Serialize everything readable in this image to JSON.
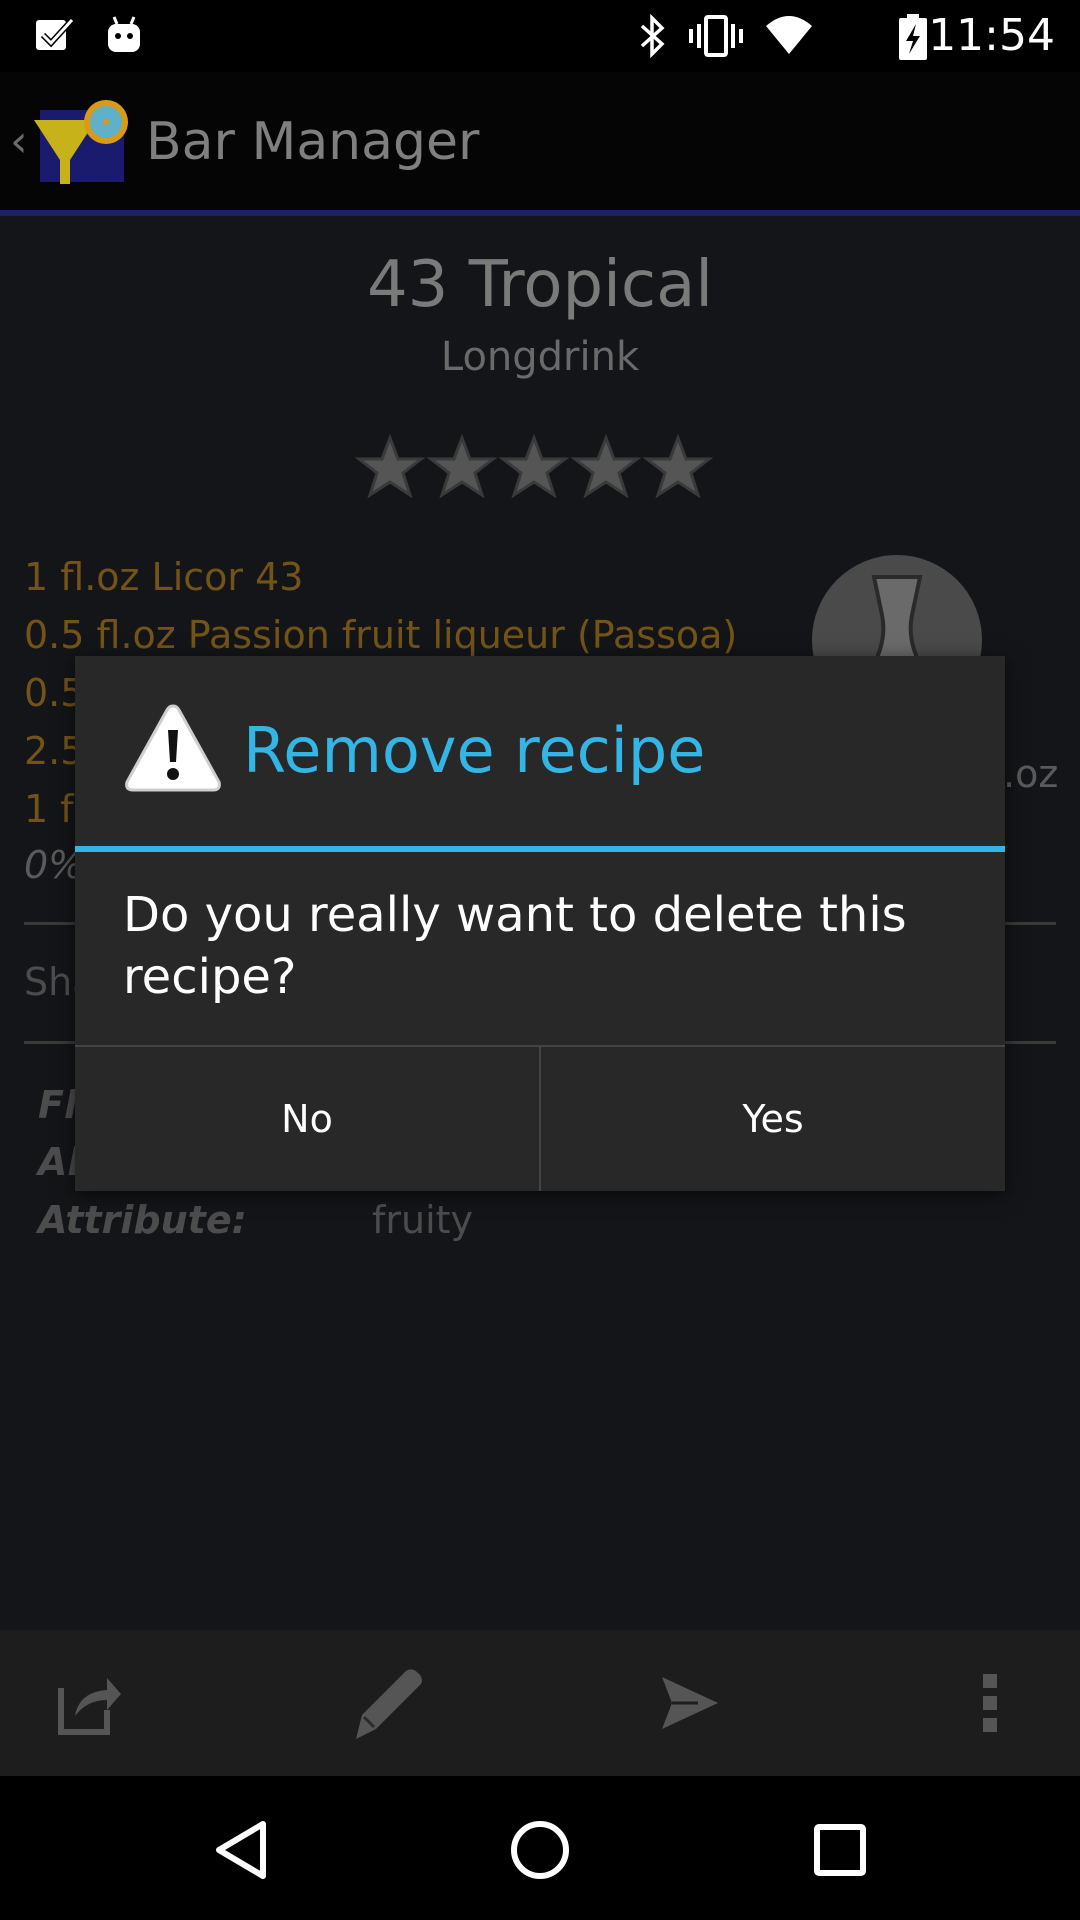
{
  "status_bar": {
    "time": "11:54",
    "left_icons": [
      "checkbox-notification-icon",
      "android-notification-icon"
    ],
    "right_icons": [
      "bluetooth-icon",
      "vibrate-icon",
      "wifi-icon",
      "battery-charging-icon"
    ]
  },
  "action_bar": {
    "title": "Bar Manager",
    "up_icon": "‹"
  },
  "recipe": {
    "name": "43 Tropical",
    "category": "Longdrink",
    "rating": {
      "value": 0,
      "max": 5
    },
    "ingredients": [
      "1 fl.oz Licor 43",
      "0.5 fl.oz Passion fruit liqueur (Passoa)",
      "0.5",
      "2.5",
      "1 f"
    ],
    "ingredient_amount_right": ".oz",
    "percent": "0%",
    "shake": "Sha",
    "properties": [
      {
        "label": "Fl",
        "value": ""
      },
      {
        "label": "Al",
        "value": ""
      },
      {
        "label": "Attribute:",
        "value": "fruity"
      }
    ]
  },
  "dialog": {
    "title": "Remove recipe",
    "message": "Do you really want to delete this recipe?",
    "no_label": "No",
    "yes_label": "Yes",
    "accent_color": "#33b5e5"
  },
  "bottom_bar": {
    "actions": [
      "share-icon",
      "edit-pencil-icon",
      "send-icon",
      "overflow-menu-icon"
    ]
  },
  "nav_bar": {
    "buttons": [
      "back-icon",
      "home-icon",
      "recents-icon"
    ]
  }
}
